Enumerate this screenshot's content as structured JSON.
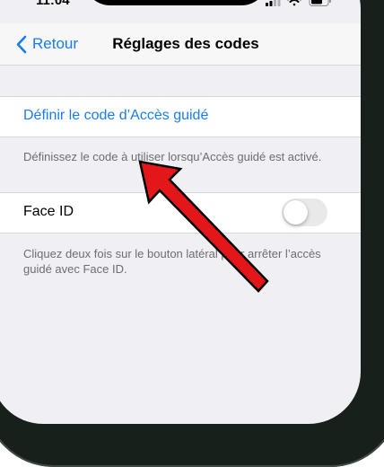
{
  "status_bar": {
    "time": "11:04",
    "icons": [
      "signal-icon",
      "wifi-icon",
      "battery-icon"
    ]
  },
  "nav": {
    "back_label": "Retour",
    "title": "Réglages des codes"
  },
  "passcode_section": {
    "label": "Définir le code d’Accès guidé",
    "footer": "Définissez le code à utiliser lorsqu’Accès guidé est activé."
  },
  "faceid_section": {
    "label": "Face ID",
    "toggle_on": false,
    "footer": "Cliquez deux fois sur le bouton latéral pour arrêter l’accès guidé avec Face ID."
  },
  "colors": {
    "accent": "#1b7cf0",
    "background": "#efeff4",
    "arrow": "#e3171a"
  }
}
